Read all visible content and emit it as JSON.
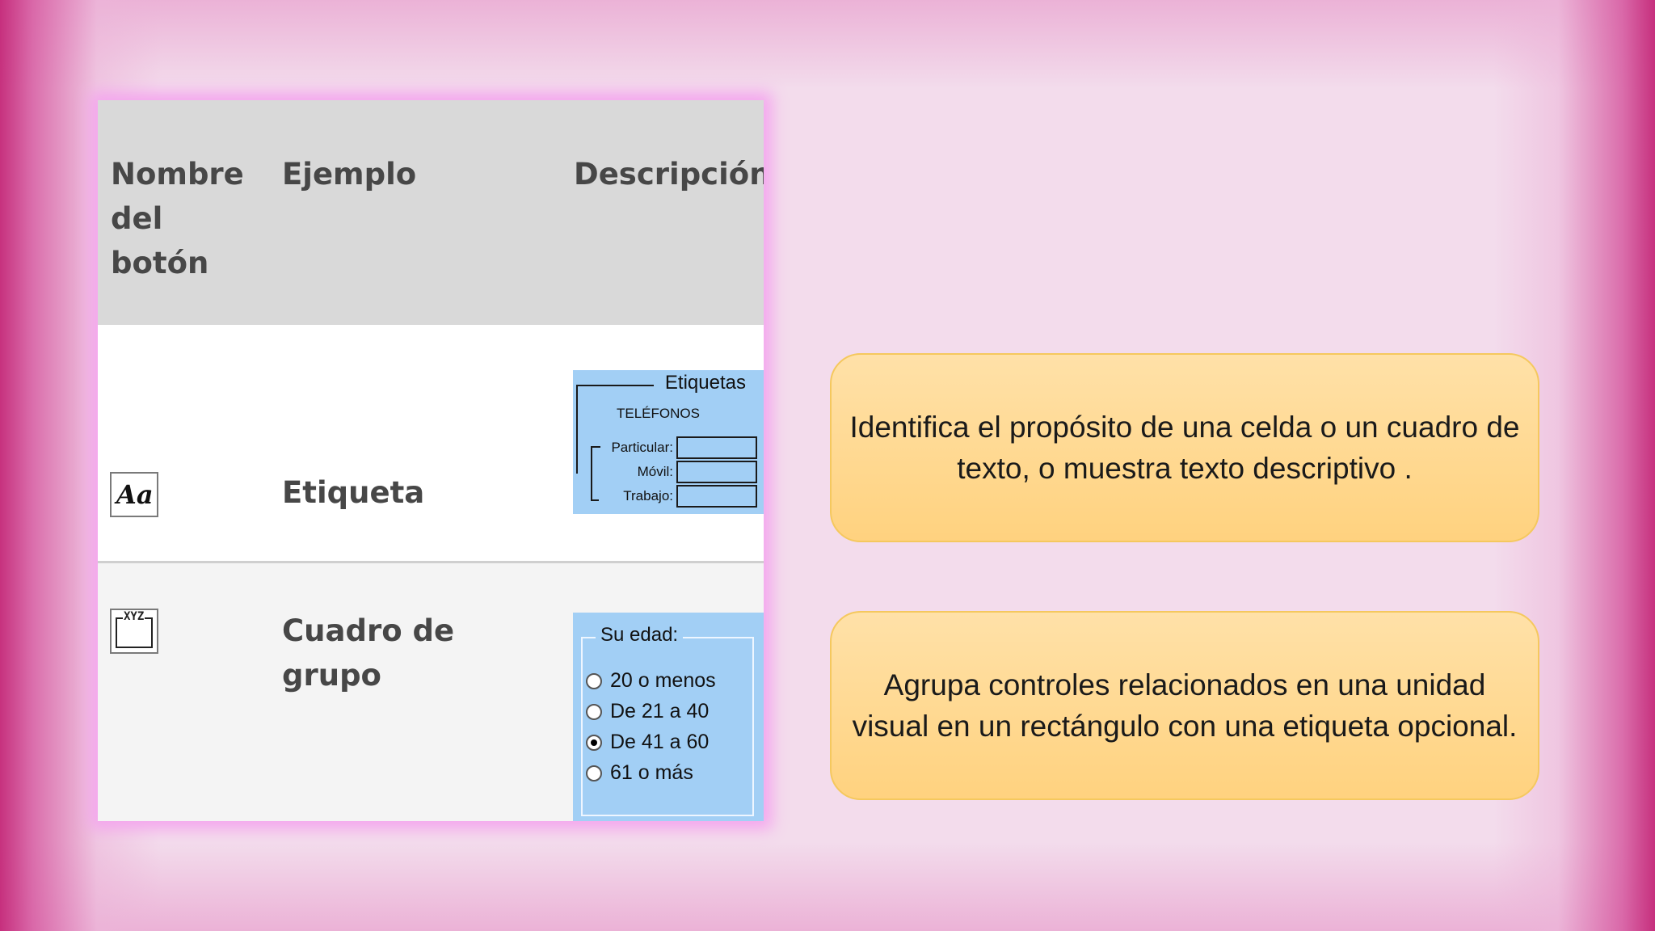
{
  "table": {
    "headers": [
      "Nombre del botón",
      "Ejemplo",
      "Descripción"
    ],
    "header_name_lines": [
      "Nombre",
      "del",
      "botón"
    ],
    "rows": [
      {
        "icon": "label-control-icon",
        "icon_text": "Aa",
        "name": "Etiqueta",
        "example": {
          "title": "Etiquetas",
          "heading": "TELÉFONOS",
          "fields": [
            "Particular:",
            "Móvil:",
            "Trabajo:"
          ]
        }
      },
      {
        "icon": "group-box-control-icon",
        "icon_text": "XYZ",
        "name_lines": [
          "Cuadro de",
          "grupo"
        ],
        "example": {
          "legend": "Su edad:",
          "options": [
            "20 o menos",
            "De 21 a 40",
            "De 41 a 60",
            "61 o más"
          ],
          "selected_index": 2
        }
      }
    ]
  },
  "descriptions": [
    "Identifica el propósito de una celda o un cuadro de texto, o muestra texto descriptivo .",
    "Agrupa controles relacionados en una unidad visual en un rectángulo con una etiqueta opcional."
  ],
  "colors": {
    "accent_pink": "#c42878",
    "table_header": "#d9d9d9",
    "example_blue": "#a2cff5",
    "desc_box": "#ffd27f"
  }
}
